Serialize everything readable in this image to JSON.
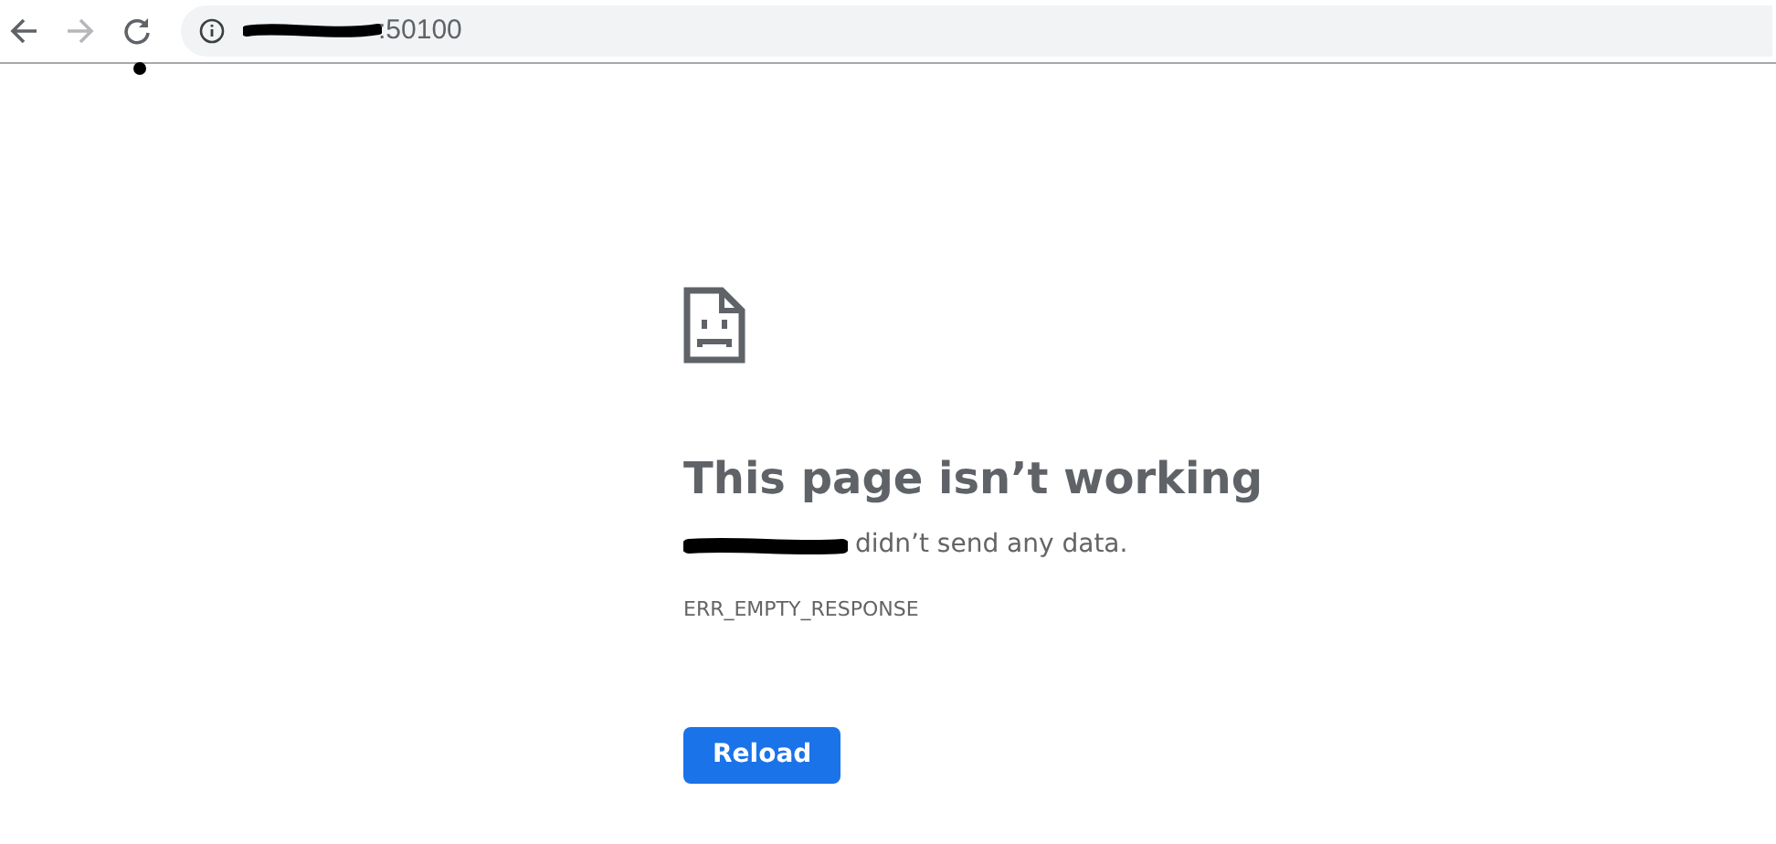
{
  "toolbar": {
    "back_enabled": true,
    "forward_enabled": false,
    "url": ":50100"
  },
  "error": {
    "title": "This page isn’t working",
    "message": "didn’t send any data.",
    "code": "ERR_EMPTY_RESPONSE",
    "button": "Reload"
  }
}
